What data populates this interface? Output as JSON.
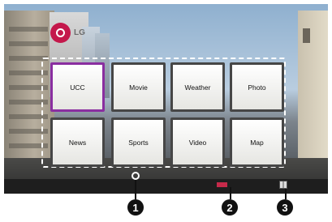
{
  "app": {
    "background_brand_text": "LG"
  },
  "menu": {
    "tiles": [
      {
        "label": "UCC",
        "selected": true
      },
      {
        "label": "Movie"
      },
      {
        "label": "Weather"
      },
      {
        "label": "Photo"
      },
      {
        "label": "News"
      },
      {
        "label": "Sports"
      },
      {
        "label": "Video"
      },
      {
        "label": "Map"
      }
    ]
  },
  "callouts": [
    "1",
    "2",
    "3"
  ],
  "colors": {
    "selection_border": "#8a2ea0",
    "tile_border": "#464646",
    "status_red": "#c62a4a",
    "callout_fill": "#111111"
  },
  "icons": {
    "status_right": "book-icon",
    "focus_anchor": "ring-icon"
  }
}
